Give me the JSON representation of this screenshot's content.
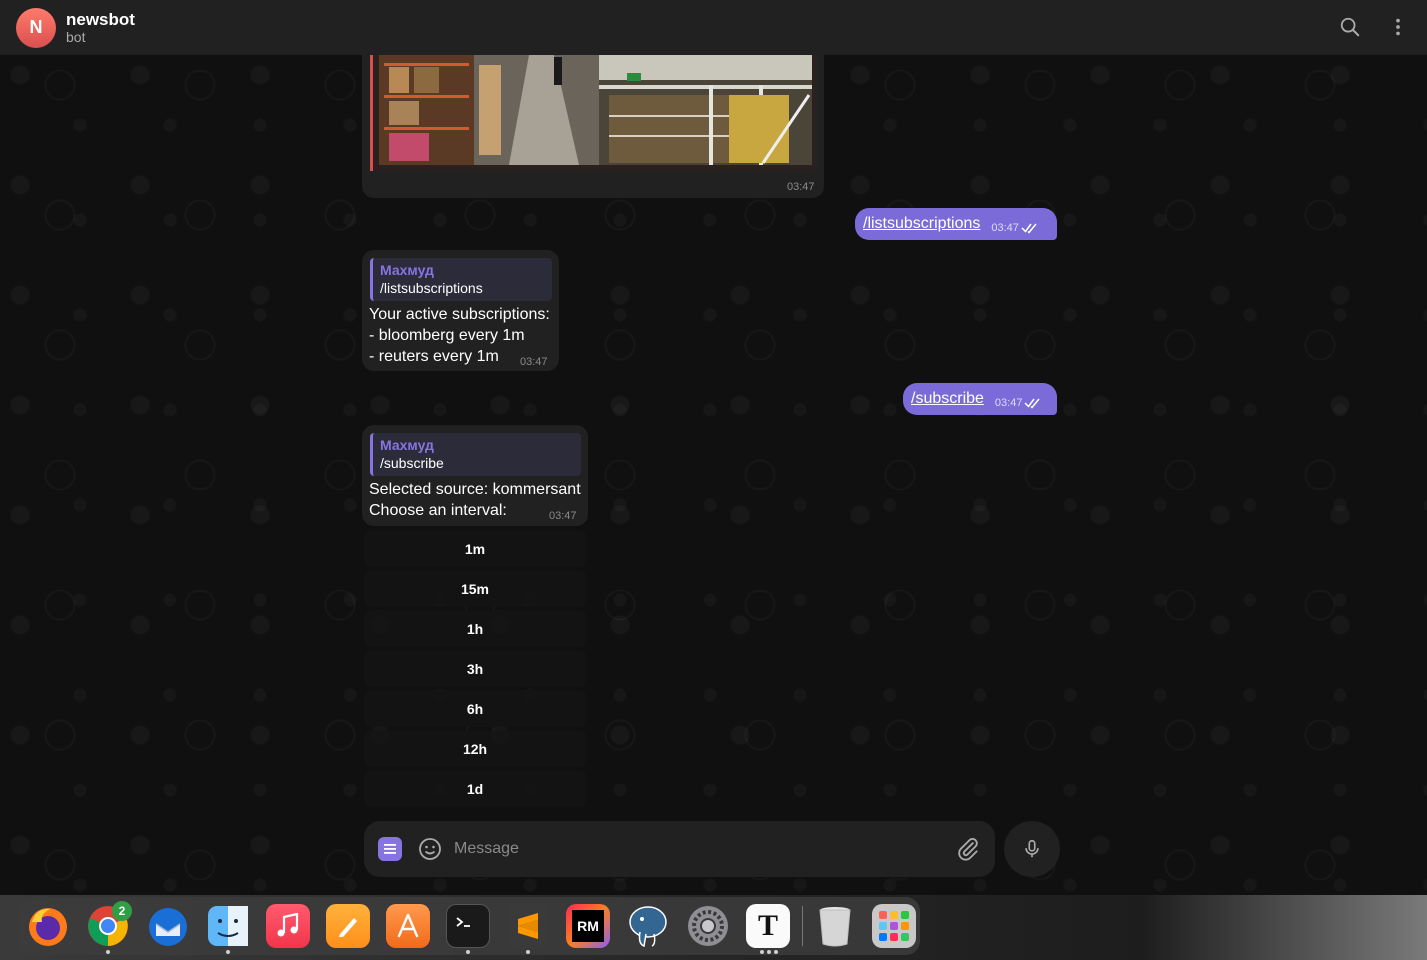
{
  "header": {
    "avatar_letter": "N",
    "title": "newsbot",
    "status": "bot"
  },
  "messages": {
    "photo_time": "03:47",
    "out1": {
      "text": "/listsubscriptions",
      "time": "03:47"
    },
    "in1": {
      "reply_name": "Махмуд",
      "reply_text": "/listsubscriptions",
      "text": "Your active subscriptions:\n- bloomberg every 1m\n- reuters every 1m",
      "time": "03:47"
    },
    "out2": {
      "text": "/subscribe",
      "time": "03:47"
    },
    "in2": {
      "reply_name": "Махмуд",
      "reply_text": "/subscribe",
      "text": "Selected source: kommersant\nChoose an interval:",
      "time": "03:47"
    }
  },
  "keyboard": [
    "1m",
    "15m",
    "1h",
    "3h",
    "6h",
    "12h",
    "1d"
  ],
  "composer": {
    "placeholder": "Message"
  },
  "dock": {
    "chrome_badge": "2",
    "items": [
      "firefox-icon",
      "chrome-icon",
      "thunderbird-icon",
      "finder-icon",
      "music-icon",
      "pages-icon",
      "app-store-icon",
      "terminal-icon",
      "sublime-text-icon",
      "rubymine-icon",
      "postgresql-icon",
      "system-settings-icon",
      "typora-icon",
      "trash-icon",
      "launchpad-icon"
    ],
    "rubymine_label": "RM",
    "typora_label": "T"
  },
  "colors": {
    "accent": "#8774e1",
    "outgoing": "#7b6bd8",
    "bubble": "#212121"
  }
}
